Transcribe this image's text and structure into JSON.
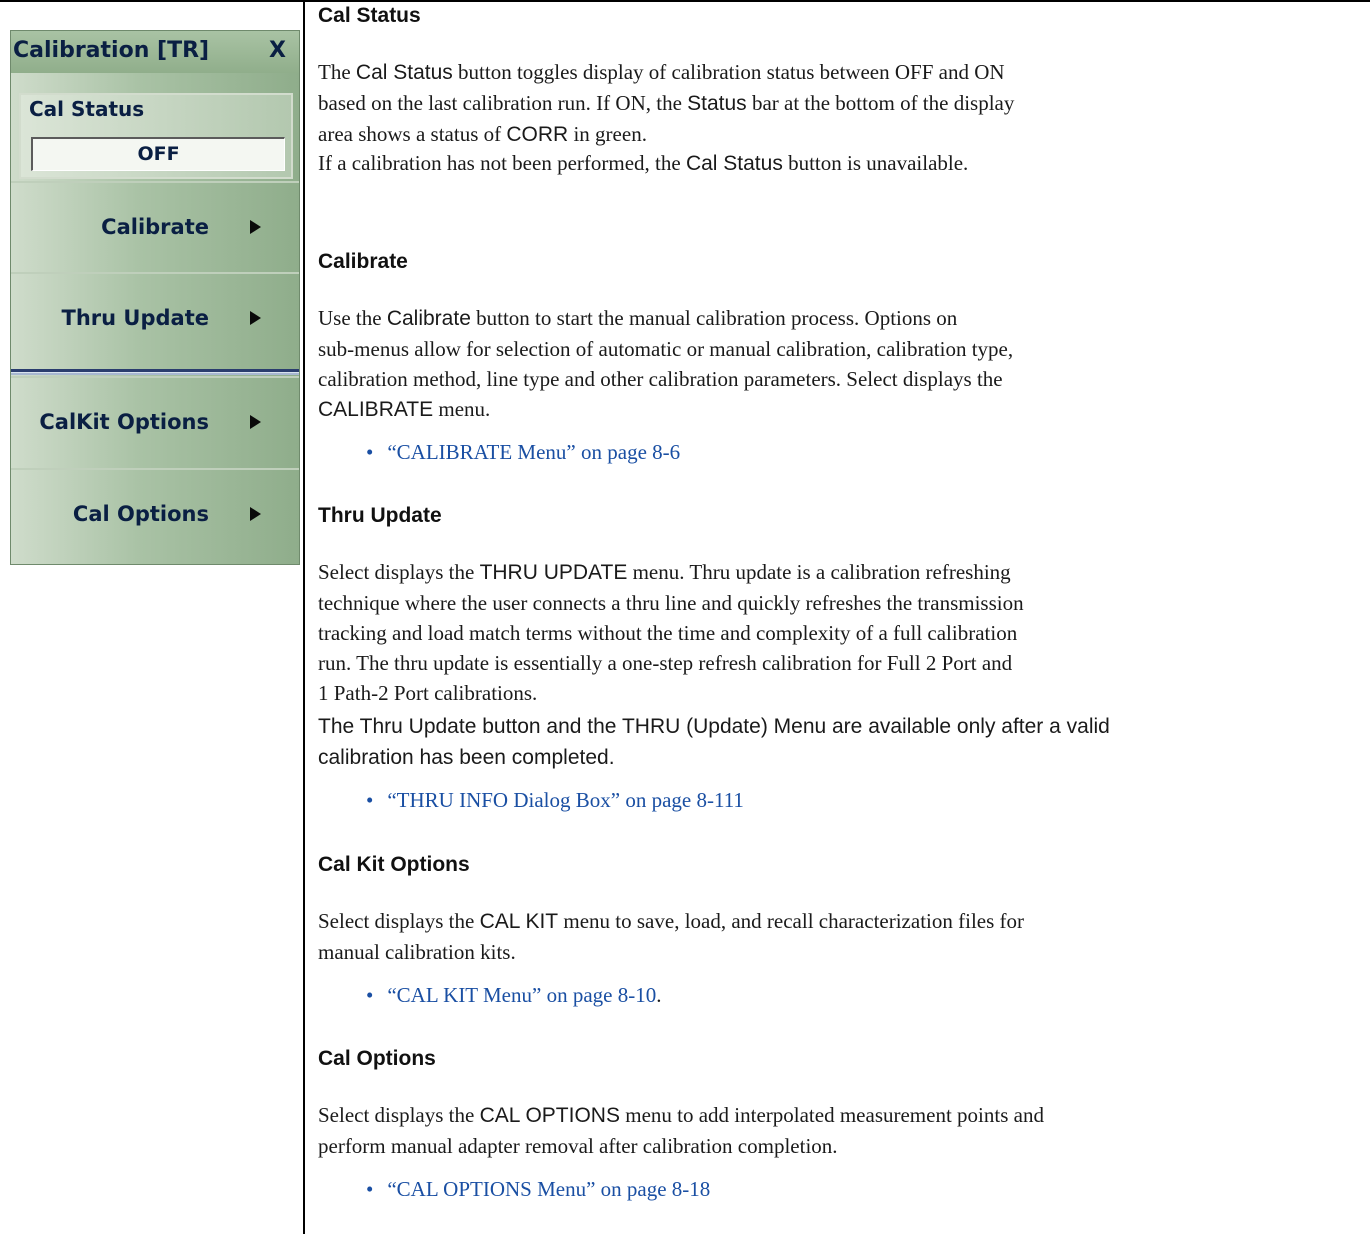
{
  "menu": {
    "title": "Calibration [TR]",
    "close": "X",
    "cal_status": {
      "label": "Cal Status",
      "value": "OFF"
    },
    "items": [
      {
        "label": "Calibrate"
      },
      {
        "label": "Thru Update"
      },
      {
        "label": "CalKit Options"
      },
      {
        "label": "Cal Options"
      }
    ]
  },
  "doc": {
    "cal_status": {
      "heading": "Cal Status",
      "p1": [
        {
          "t": "The ",
          "sans": false
        },
        {
          "t": "Cal Status",
          "sans": true
        },
        {
          "t": " button toggles display of calibration status between OFF and ON",
          "sans": false
        },
        {
          "t": "based on the last calibration run. If ON, the ",
          "sans": false,
          "br": true
        },
        {
          "t": "Status",
          "sans": true
        },
        {
          "t": " bar at the bottom of the display",
          "sans": false
        },
        {
          "t": "area shows a status of ",
          "sans": false,
          "br": true
        },
        {
          "t": "CORR",
          "sans": true
        },
        {
          "t": " in green.",
          "sans": false
        }
      ],
      "p2": [
        {
          "t": "If a calibration has not been performed, the ",
          "sans": false
        },
        {
          "t": "Cal Status",
          "sans": true
        },
        {
          "t": " button is unavailable.",
          "sans": false
        }
      ]
    },
    "calibrate": {
      "heading": "Calibrate",
      "p1": [
        {
          "t": "Use the ",
          "sans": false
        },
        {
          "t": "Calibrate",
          "sans": true
        },
        {
          "t": " button to start the manual calibration process. Options on",
          "sans": false
        },
        {
          "t": "sub-menus allow for selection of automatic or manual calibration, calibration type,",
          "sans": false,
          "br": true
        },
        {
          "t": "calibration method, line type and other calibration parameters. Select displays the",
          "sans": false,
          "br": true
        },
        {
          "t": "CALIBRATE",
          "sans": true,
          "br": true
        },
        {
          "t": " menu.",
          "sans": false
        }
      ],
      "link": {
        "text": "“CALIBRATE Menu” on page 8-6",
        "tail": ""
      }
    },
    "thru_update": {
      "heading": "Thru Update",
      "p1": [
        {
          "t": "Select displays the ",
          "sans": false
        },
        {
          "t": "THRU UPDATE",
          "sans": true
        },
        {
          "t": " menu. Thru update is a calibration refreshing",
          "sans": false
        },
        {
          "t": "technique where the user connects a thru line and quickly refreshes the transmission",
          "sans": false,
          "br": true
        },
        {
          "t": "tracking and load match terms without the time and complexity of a full calibration",
          "sans": false,
          "br": true
        },
        {
          "t": "run. The thru update is essentially a one-step refresh calibration for Full 2 Port and",
          "sans": false,
          "br": true
        },
        {
          "t": "1 Path-2 Port calibrations.",
          "sans": false,
          "br": true
        }
      ],
      "p2": [
        {
          "t": "The Thru Update button and the THRU (Update) Menu are available only after a valid",
          "sans": true
        },
        {
          "t": "calibration has been completed.",
          "sans": true,
          "br": true
        }
      ],
      "link": {
        "text": "“THRU INFO Dialog Box” on page 8-111",
        "tail": ""
      }
    },
    "calkit_options": {
      "heading": "Cal Kit Options",
      "p1": [
        {
          "t": "Select displays the ",
          "sans": false
        },
        {
          "t": "CAL KIT",
          "sans": true
        },
        {
          "t": " menu to save, load, and recall characterization files for",
          "sans": false
        },
        {
          "t": "manual calibration kits.",
          "sans": false,
          "br": true
        }
      ],
      "link": {
        "text": "“CAL KIT Menu” on page 8-10",
        "tail": "."
      }
    },
    "cal_options": {
      "heading": "Cal Options",
      "p1": [
        {
          "t": "Select displays the ",
          "sans": false
        },
        {
          "t": "CAL OPTIONS",
          "sans": true
        },
        {
          "t": " menu to add interpolated measurement points and",
          "sans": false
        },
        {
          "t": "perform manual adapter removal after calibration completion.",
          "sans": false,
          "br": true
        }
      ],
      "link": {
        "text": "“CAL OPTIONS Menu” on page 8-18",
        "tail": ""
      }
    }
  }
}
